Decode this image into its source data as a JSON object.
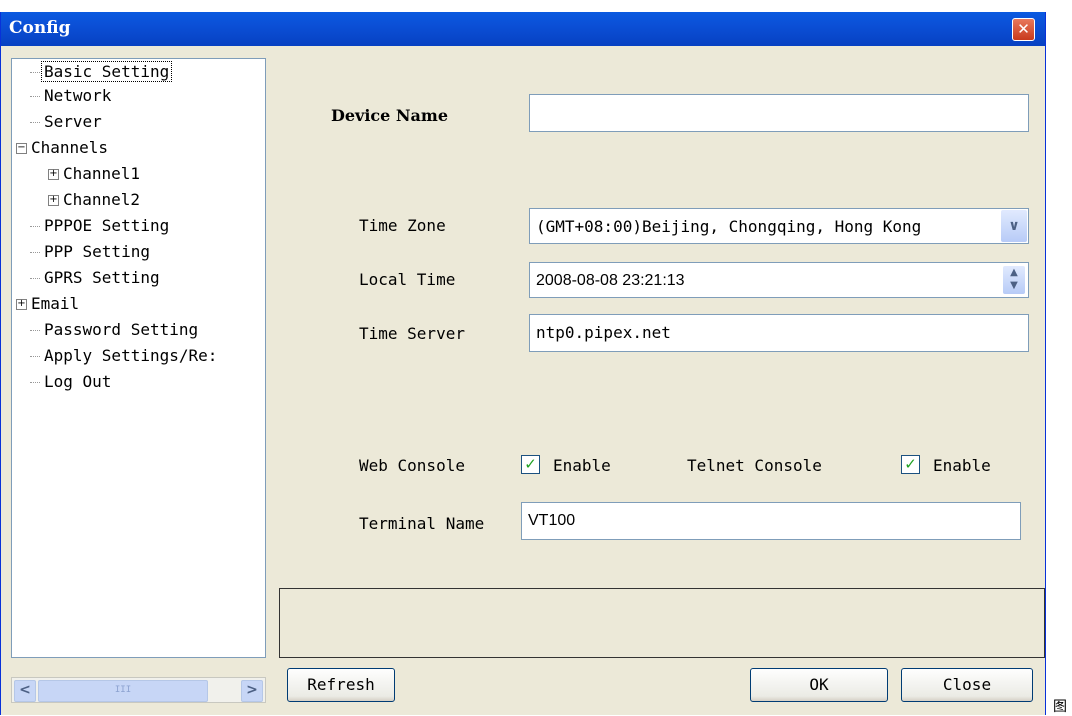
{
  "window": {
    "title": "Config",
    "close_glyph": "✕"
  },
  "tree": {
    "items": [
      {
        "label": "Basic Setting",
        "selected": true
      },
      {
        "label": "Network"
      },
      {
        "label": "Server"
      },
      {
        "label": "Channels",
        "expander": "−"
      },
      {
        "label": "Channel1",
        "expander": "+"
      },
      {
        "label": "Channel2",
        "expander": "+"
      },
      {
        "label": "PPPOE Setting"
      },
      {
        "label": "PPP Setting"
      },
      {
        "label": "GPRS Setting"
      },
      {
        "label": "Email",
        "expander": "+"
      },
      {
        "label": "Password Setting"
      },
      {
        "label": "Apply Settings/Re:"
      },
      {
        "label": "Log Out"
      }
    ]
  },
  "scrollbar": {
    "left": "<",
    "right": ">",
    "thumb": "III"
  },
  "form": {
    "device_name_label": "Device Name",
    "device_name_value": "",
    "time_zone_label": "Time Zone",
    "time_zone_value": "(GMT+08:00)Beijing, Chongqing, Hong Kong",
    "local_time_label": "Local Time",
    "local_time_value": "2008-08-08 23:21:13",
    "time_server_label": "Time Server",
    "time_server_value": "ntp0.pipex.net",
    "web_console_label": "Web Console",
    "web_console_enable": "Enable",
    "telnet_console_label": "Telnet Console",
    "telnet_console_enable": "Enable",
    "terminal_name_label": "Terminal Name",
    "terminal_name_value": "VT100"
  },
  "buttons": {
    "refresh": "Refresh",
    "ok": "OK",
    "close": "Close"
  },
  "side_glyph": "图",
  "colors": {
    "titlebar": "#0b4fd6",
    "dialog_bg": "#ece9d8",
    "check": "#21a121"
  }
}
